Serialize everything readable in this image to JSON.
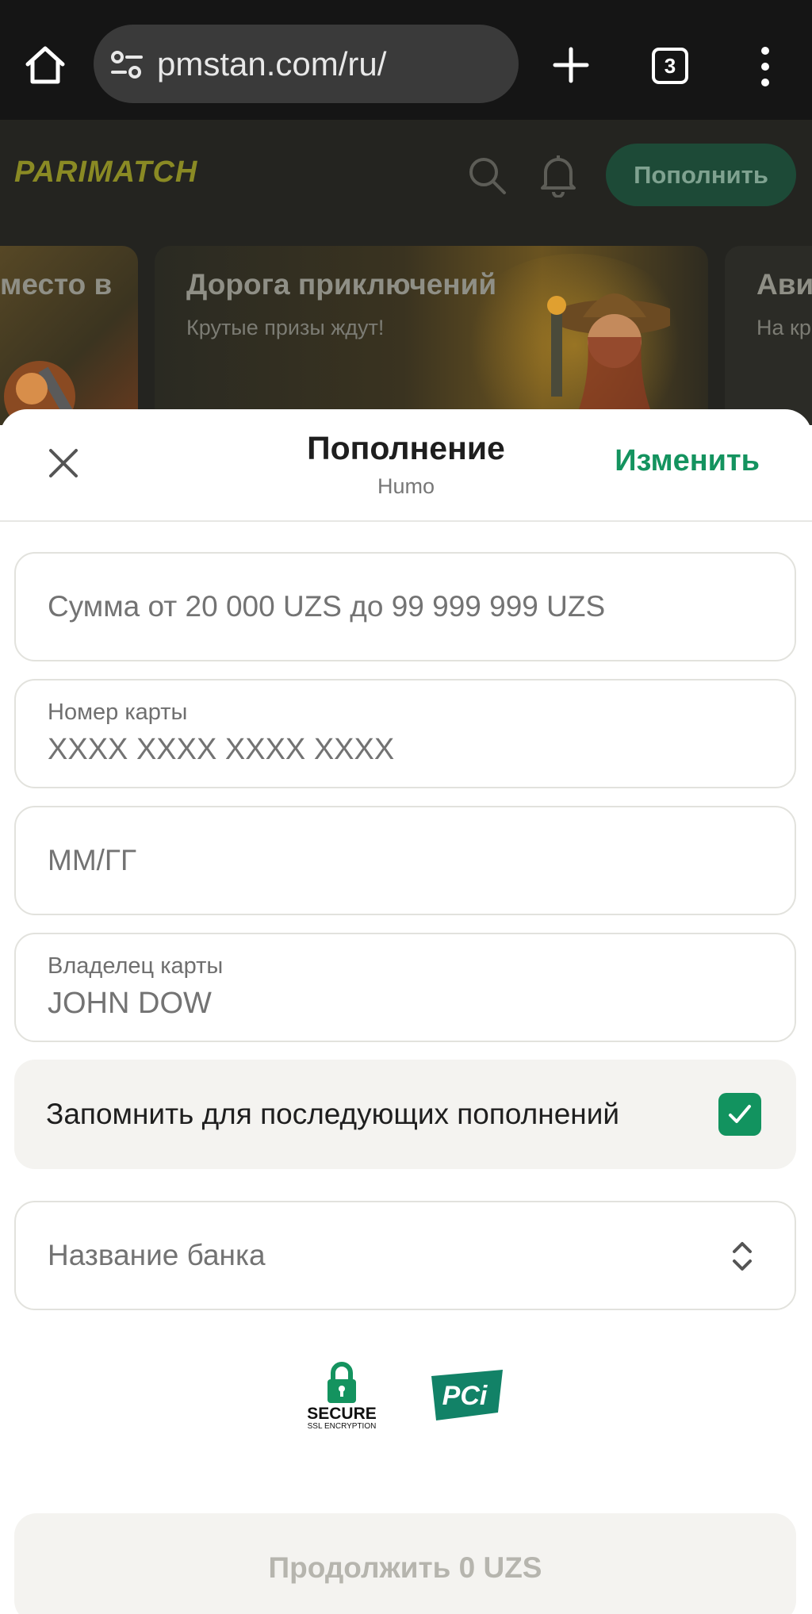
{
  "browser": {
    "url": "pmstan.com/ru/",
    "tab_count": "3"
  },
  "site": {
    "logo": "PARIMATCH",
    "deposit_button": "Пополнить"
  },
  "banners": [
    {
      "title": "место в",
      "subtitle": ""
    },
    {
      "title": "Дорога приключений",
      "subtitle": "Крутые призы ждут!"
    },
    {
      "title": "Ави",
      "subtitle": "На кр"
    }
  ],
  "sheet": {
    "title": "Пополнение",
    "subtitle": "Humo",
    "change_link": "Изменить",
    "amount_placeholder": "Сумма от 20 000 UZS до 99 999 999 UZS",
    "card_number_label": "Номер карты",
    "card_number_placeholder": "XXXX XXXX XXXX XXXX",
    "expiry_placeholder": "ММ/ГГ",
    "holder_label": "Владелец карты",
    "holder_placeholder": "JOHN DOW",
    "remember_label": "Запомнить для последующих пополнений",
    "remember_checked": true,
    "bank_placeholder": "Название банка",
    "secure_badge": {
      "line1": "SECURE",
      "line2": "SSL ENCRYPTION"
    },
    "pci_badge": "PCi",
    "continue_button": "Продолжить 0 UZS"
  },
  "colors": {
    "accent": "#14935f",
    "header_bg": "#242420",
    "browser_bg": "#151515"
  }
}
